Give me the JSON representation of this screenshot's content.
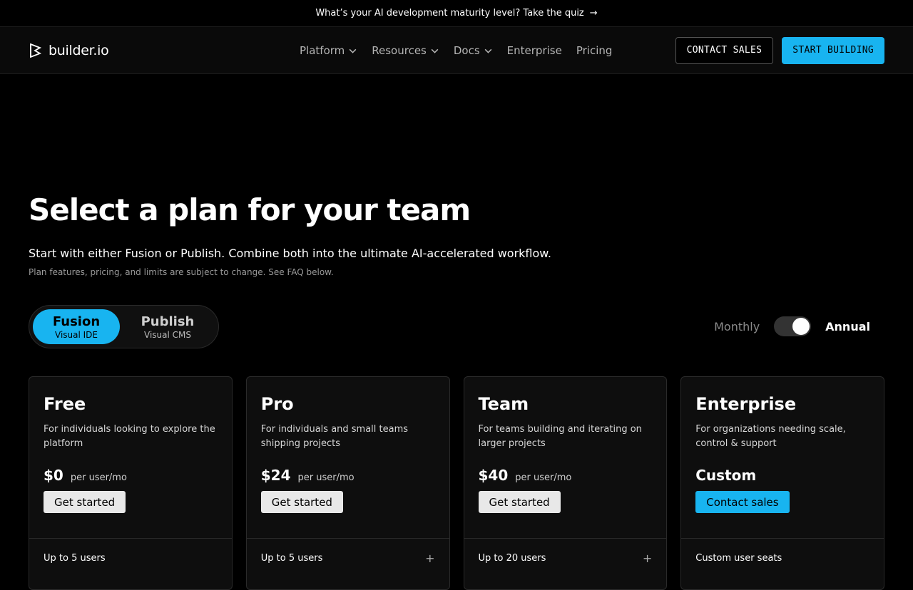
{
  "announcement": {
    "text": "What’s your AI development maturity level? Take the quiz",
    "arrow": "→"
  },
  "nav": {
    "logo_text": "builder.io",
    "links": [
      {
        "label": "Platform",
        "has_menu": true
      },
      {
        "label": "Resources",
        "has_menu": true
      },
      {
        "label": "Docs",
        "has_menu": true
      },
      {
        "label": "Enterprise",
        "has_menu": false
      },
      {
        "label": "Pricing",
        "has_menu": false
      }
    ],
    "contact_sales": "CONTACT SALES",
    "start_building": "START BUILDING"
  },
  "hero": {
    "title": "Select a plan for your team",
    "subtitle": "Start with either Fusion or Publish. Combine both into the ultimate AI-accelerated workflow.",
    "fine_print": "Plan features, pricing, and limits are subject to change. See FAQ below."
  },
  "product_toggle": [
    {
      "title": "Fusion",
      "subtitle": "Visual IDE",
      "selected": true
    },
    {
      "title": "Publish",
      "subtitle": "Visual CMS",
      "selected": false
    }
  ],
  "billing": {
    "monthly": "Monthly",
    "annual": "Annual",
    "annual_selected": true
  },
  "plans": [
    {
      "name": "Free",
      "description": "For individuals looking to explore the platform",
      "price": "$0",
      "per": "per user/mo",
      "cta": "Get started",
      "feature": "Up to 5 users"
    },
    {
      "name": "Pro",
      "description": "For individuals and small teams shipping projects",
      "price": "$24",
      "per": "per user/mo",
      "cta": "Get started",
      "feature": "Up to 5 users"
    },
    {
      "name": "Team",
      "description": "For teams building and iterating on larger projects",
      "price": "$40",
      "per": "per user/mo",
      "cta": "Get started",
      "feature": "Up to 20 users"
    },
    {
      "name": "Enterprise",
      "description": "For organizations needing scale, control & support",
      "price": "Custom",
      "cta": "Contact sales",
      "feature": "Custom user seats"
    }
  ],
  "colors": {
    "accent": "#18b4f0",
    "background": "#000000",
    "card": "#0e0e0e"
  }
}
